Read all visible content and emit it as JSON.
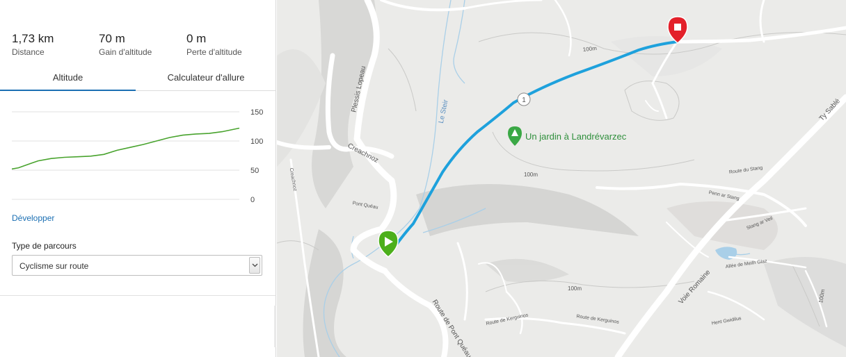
{
  "stats": [
    {
      "value": "1,73 km",
      "label": "Distance"
    },
    {
      "value": "70 m",
      "label": "Gain d'altitude"
    },
    {
      "value": "0 m",
      "label": "Perte d'altitude"
    }
  ],
  "tabs": [
    {
      "label": "Altitude",
      "active": true
    },
    {
      "label": "Calculateur d'allure",
      "active": false
    }
  ],
  "chart_data": {
    "type": "area",
    "x": [
      0,
      0.05,
      0.1,
      0.15,
      0.2,
      0.3,
      0.4,
      0.5,
      0.6,
      0.7,
      0.8,
      0.9,
      1.0,
      1.1,
      1.2,
      1.3,
      1.4,
      1.5,
      1.6,
      1.73
    ],
    "y": [
      52,
      54,
      58,
      62,
      66,
      70,
      72,
      73,
      74,
      77,
      84,
      89,
      94,
      100,
      106,
      110,
      112,
      113,
      116,
      122
    ],
    "yticks": [
      150,
      100,
      50,
      0
    ],
    "ylim": [
      0,
      150
    ],
    "grid": true,
    "color": "#48a32d"
  },
  "develop_link": "Développer",
  "route_type": {
    "label": "Type de parcours",
    "selected": "Cyclisme sur route"
  },
  "map": {
    "labels": {
      "creachnoz": "Creachnoz",
      "plessis": "Plessis Lopeau",
      "le_steir": "Le Steir",
      "pont_queau": "Pont Quéau",
      "route_pont_queau": "Route de Pont Quéau",
      "jardin": "Un jardin à Landrévarzec",
      "route_stang": "Route du Stang",
      "penn_ar_stang": "Penn ar Stang",
      "stang_ar_veil": "Stang ar Veil",
      "ty_sable": "Ty Sablé",
      "voie_romaine": "Voie Romaine",
      "allee_meilh": "Allée de Meilh Glaz",
      "route_kerguinos_1": "Route de Kerguinos",
      "route_kerguinos_2": "Route de Kerguinos",
      "hent_gwidilus": "Hent Gwidilus",
      "contour_100_a": "100m",
      "contour_100_b": "100m",
      "contour_100_c": "100m",
      "contour_100_d": "100m",
      "marker_num": "1",
      "creachnoz_side": "Creachnoz"
    },
    "route_color": "#1ea1dc",
    "start_color": "#4caf1b",
    "end_color": "#e3202a"
  }
}
